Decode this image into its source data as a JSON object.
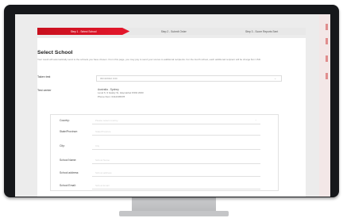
{
  "stepper": {
    "step1": "Step 1 - Select School",
    "step2": "Step 2 - Submit Order",
    "step3": "Step 3 - Score Reports Sent"
  },
  "page": {
    "title": "Select School",
    "description": "Your result will automatically send to the schools you have chosen. From this page, you may pay to send your scores to additional recipients. For the fourth school, each additional recipient will be charge $xx USD."
  },
  "taken_test": {
    "label": "Taken test",
    "value": "06/10/2022 0:00"
  },
  "test_center": {
    "label": "Test center",
    "name": "Australia - Sydney",
    "address": "Level 6, 9 Gately St, Haymarket NSW 2000",
    "phone": "Phone Num: 0412345678"
  },
  "form": {
    "fields": [
      {
        "label": "Country:",
        "placeholder": "Please select country"
      },
      {
        "label": "State/Province:",
        "placeholder": "State/Province"
      },
      {
        "label": "City:",
        "placeholder": "City"
      },
      {
        "label": "School Name:",
        "placeholder": "School Name"
      },
      {
        "label": "School address:",
        "placeholder": "School address"
      },
      {
        "label": "School Email:",
        "placeholder": "School Email"
      }
    ]
  },
  "colors": {
    "accent": "#d6121f",
    "bezel": "#16181b"
  }
}
